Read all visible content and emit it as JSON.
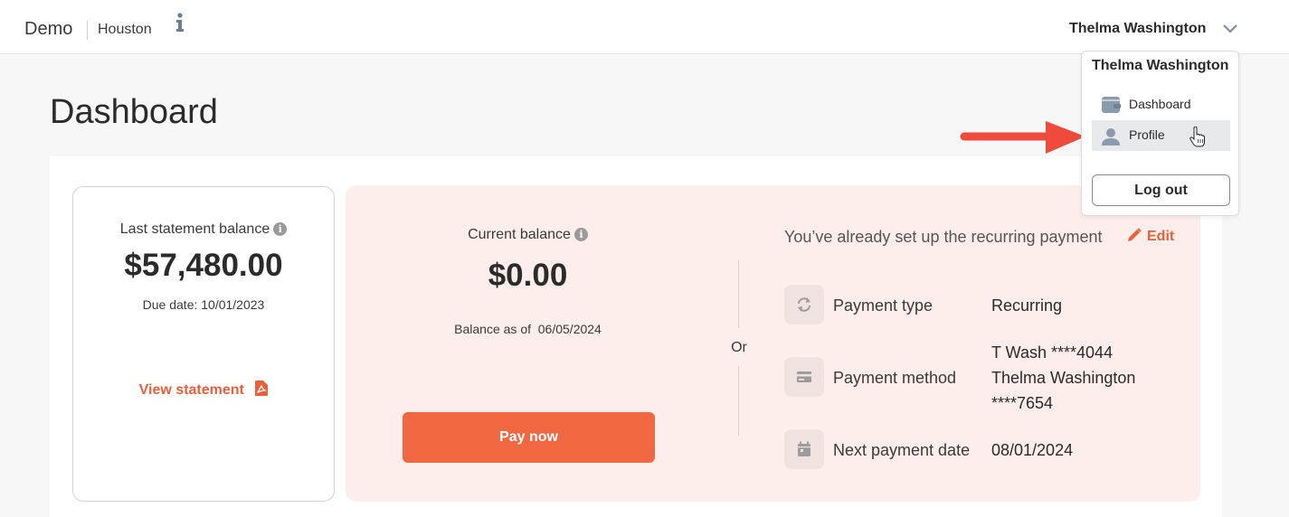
{
  "header": {
    "brand": "Demo",
    "location": "Houston",
    "user_name": "Thelma Washington"
  },
  "page": {
    "title": "Dashboard"
  },
  "last_statement": {
    "label": "Last statement balance",
    "amount": "$57,480.00",
    "due_date": "Due date: 10/01/2023",
    "view_link": "View statement"
  },
  "current": {
    "label": "Current balance",
    "amount": "$0.00",
    "as_of": "Balance as of  06/05/2024",
    "pay_button": "Pay now"
  },
  "divider_text": "Or",
  "recurring": {
    "message": "You’ve already set up the recurring payment",
    "edit_label": "Edit",
    "rows": [
      {
        "label": "Payment type",
        "value": "Recurring",
        "icon": "refresh-icon"
      },
      {
        "label": "Payment method",
        "value_lines": [
          "T Wash ****4044",
          "Thelma Washington",
          "****7654"
        ],
        "icon": "credit-card-icon"
      },
      {
        "label": "Next payment date",
        "value": "08/01/2024",
        "icon": "calendar-icon"
      }
    ]
  },
  "dropdown": {
    "name": "Thelma Washington",
    "items": [
      {
        "label": "Dashboard",
        "icon": "wallet-icon"
      },
      {
        "label": "Profile",
        "icon": "user-icon"
      }
    ],
    "logout_label": "Log out"
  },
  "colors": {
    "accent": "#ef6841",
    "link": "#e8613a",
    "card_bg": "#fdeeeb",
    "annotation_arrow": "#ef4b3c"
  }
}
